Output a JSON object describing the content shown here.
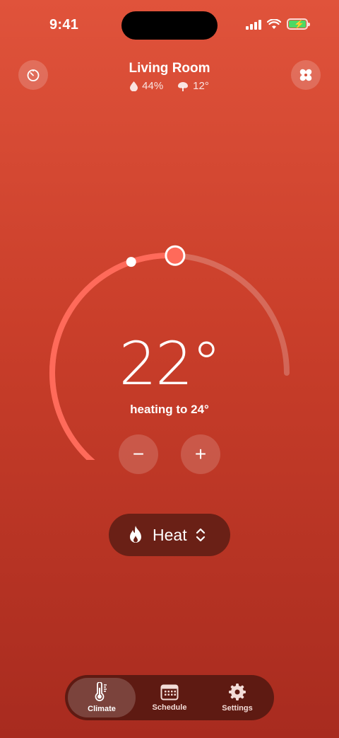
{
  "status_bar": {
    "time": "9:41"
  },
  "header": {
    "room": "Living Room",
    "humidity": "44%",
    "outdoor_temp": "12°"
  },
  "icons": {
    "timer": "timer-icon",
    "fan": "fan-icon",
    "humidity": "droplet-icon",
    "outdoor": "tree-icon",
    "mode": "flame-icon"
  },
  "thermostat": {
    "current_temp": "22°",
    "status": "heating to 24°",
    "decrease_label": "−",
    "increase_label": "+",
    "current_value": 22,
    "target_value": 24
  },
  "mode": {
    "label": "Heat"
  },
  "tabs": [
    {
      "label": "Climate",
      "active": true
    },
    {
      "label": "Schedule",
      "active": false
    },
    {
      "label": "Settings",
      "active": false
    }
  ],
  "colors": {
    "accent": "#ff6a5a",
    "background_top": "#e0533b",
    "background_bottom": "#a82b1f"
  }
}
